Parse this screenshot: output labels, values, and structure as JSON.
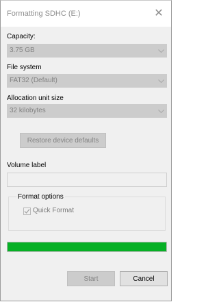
{
  "window": {
    "title": "Formatting SDHC (E:)"
  },
  "capacity": {
    "label": "Capacity:",
    "value": "3.75 GB"
  },
  "file_system": {
    "label": "File system",
    "value": "FAT32 (Default)"
  },
  "allocation": {
    "label": "Allocation unit size",
    "value": "32 kilobytes"
  },
  "restore_button": {
    "label": "Restore device defaults"
  },
  "volume_label": {
    "label": "Volume label",
    "value": ""
  },
  "format_options": {
    "title": "Format options",
    "quick_format": {
      "label": "Quick Format",
      "checked": true
    }
  },
  "progress": {
    "fraction": 1.0,
    "color": "#06b025"
  },
  "buttons": {
    "start": "Start",
    "cancel": "Cancel"
  },
  "icons": {
    "close": "close-icon",
    "dropdown": "chevron-down-icon",
    "check": "check-icon"
  }
}
